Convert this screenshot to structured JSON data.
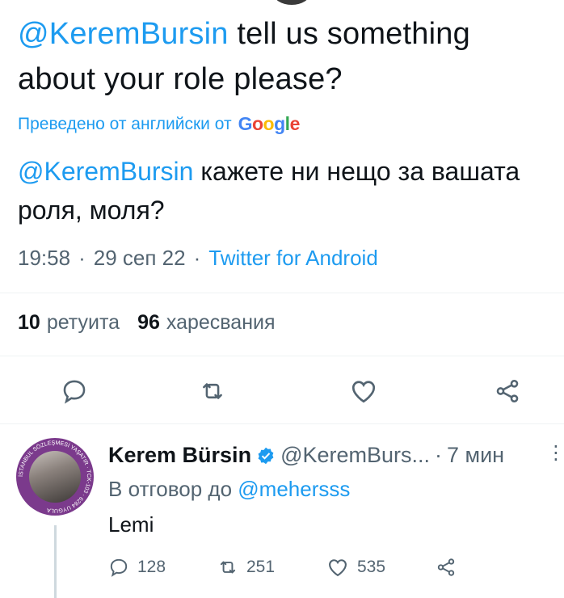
{
  "tweet": {
    "mention": "@KeremBursin",
    "text": " tell us something about your role please?",
    "translated_label": "Преведено от английски от",
    "translator_brand": "Google",
    "translation_mention": "@KeremBursin",
    "translation_text": " кажете ни нещо за вашата роля, моля?",
    "time": "19:58",
    "date": "29 сеп 22",
    "separator": "·",
    "source_app": "Twitter for Android"
  },
  "stats": {
    "retweets_count": "10",
    "retweets_label": "ретуита",
    "likes_count": "96",
    "likes_label": "харесвания"
  },
  "actions": [
    "reply-icon",
    "retweet-icon",
    "like-icon",
    "share-icon"
  ],
  "reply": {
    "name": "Kerem Bürsin",
    "handle": "@KeremBurs...",
    "separator": "·",
    "time": "7 мин",
    "reply_to_label": "В отговор до",
    "reply_to_handle": "@mehersss",
    "text": "Lemi",
    "reply_count": "128",
    "retweet_count": "251",
    "like_count": "535",
    "avatar_ring_text": "İSTANBUL SÖZLEŞMESİ YAŞATIR · TCK-103 · 6284 UYGULA"
  },
  "colors": {
    "accent": "#1d9bf0",
    "secondary_text": "#536471",
    "primary_text": "#0f1419",
    "avatar_ring": "#7b3a8c",
    "verified": "#1d9bf0"
  }
}
